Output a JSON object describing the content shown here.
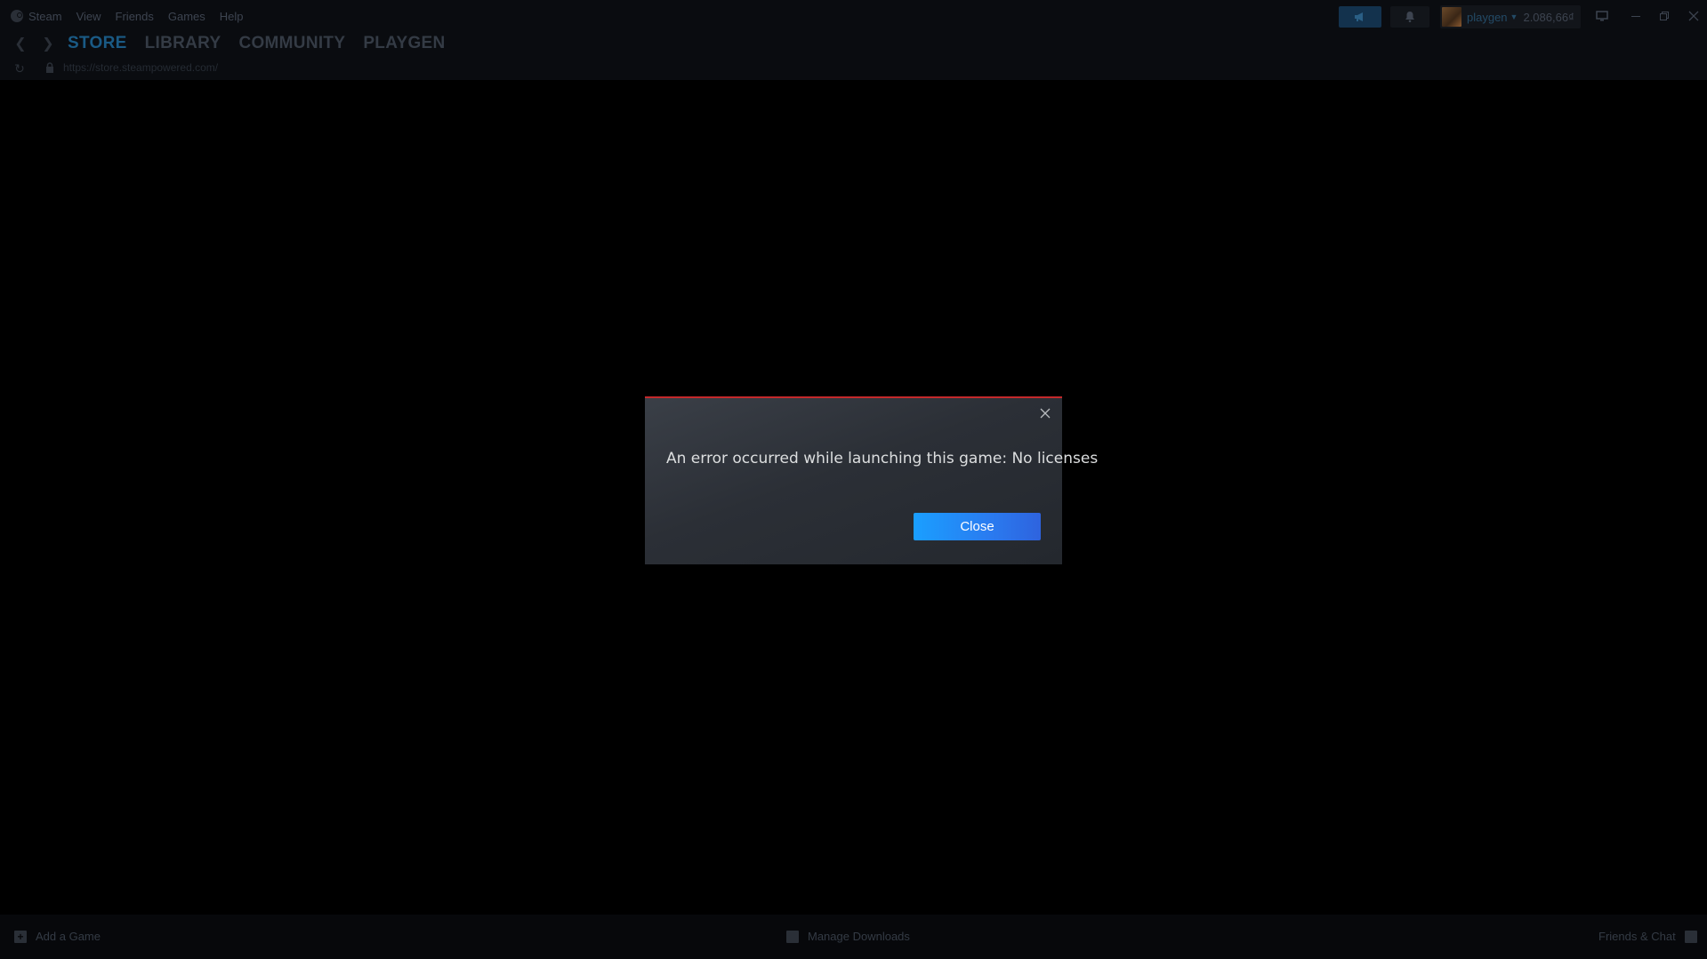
{
  "menu": {
    "items": [
      "Steam",
      "View",
      "Friends",
      "Games",
      "Help"
    ]
  },
  "account": {
    "username": "playgen",
    "balance": "2.086,66₫"
  },
  "nav": {
    "tabs": [
      "STORE",
      "LIBRARY",
      "COMMUNITY",
      "PLAYGEN"
    ],
    "active_tab": "STORE"
  },
  "browser": {
    "url": "https://store.steampowered.com/"
  },
  "dialog": {
    "message": "An error occurred while launching this game: No licenses",
    "close_button_label": "Close",
    "accent_color": "#c4292b"
  },
  "bottom": {
    "add_game_label": "Add a Game",
    "manage_downloads_label": "Manage Downloads",
    "friends_chat_label": "Friends & Chat"
  },
  "colors": {
    "background": "#000000",
    "primary_button": "#1a9fff"
  }
}
